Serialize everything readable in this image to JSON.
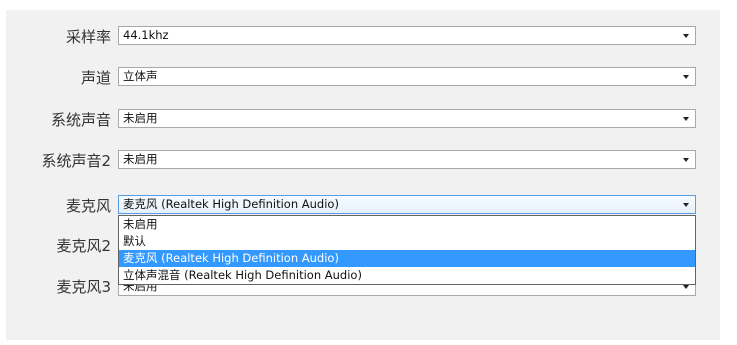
{
  "settings": {
    "sample_rate": {
      "label": "采样率",
      "value": "44.1khz"
    },
    "channels": {
      "label": "声道",
      "value": "立体声"
    },
    "system_audio": {
      "label": "系统声音",
      "value": "未启用"
    },
    "system_audio_2": {
      "label": "系统声音2",
      "value": "未启用"
    },
    "microphone": {
      "label": "麦克风",
      "value": "麦克风 (Realtek High Definition Audio)"
    },
    "microphone_2": {
      "label": "麦克风2",
      "value": ""
    },
    "microphone_3": {
      "label": "麦克风3",
      "value": "未启用"
    }
  },
  "microphone_dropdown": {
    "options": [
      "未启用",
      "默认",
      "麦克风 (Realtek High Definition Audio)",
      "立体声混音 (Realtek High Definition Audio)"
    ],
    "selected_index": 2
  },
  "icons": {
    "dropdown_arrow": "chevron-down-icon"
  }
}
